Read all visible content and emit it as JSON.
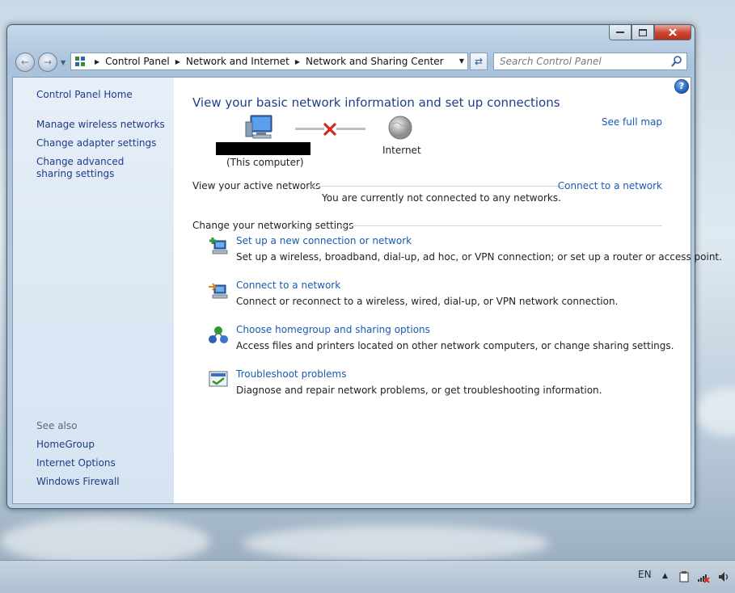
{
  "window": {
    "minimize_icon": "minimize-icon",
    "maximize_icon": "maximize-icon",
    "close_icon": "close-icon"
  },
  "nav": {
    "back_icon": "back-arrow-icon",
    "forward_icon": "forward-arrow-icon",
    "breadcrumbs": [
      "Control Panel",
      "Network and Internet",
      "Network and Sharing Center"
    ],
    "refresh_icon": "refresh-icon",
    "search_placeholder": "Search Control Panel"
  },
  "sidebar": {
    "home": "Control Panel Home",
    "links": [
      "Manage wireless networks",
      "Change adapter settings",
      "Change advanced sharing settings"
    ],
    "see_also_label": "See also",
    "see_also": [
      "HomeGroup",
      "Internet Options",
      "Windows Firewall"
    ]
  },
  "main": {
    "title": "View your basic network information and set up connections",
    "see_full_map": "See full map",
    "this_computer": "(This computer)",
    "internet": "Internet",
    "active_networks_label": "View your active networks",
    "connect_link": "Connect to a network",
    "not_connected": "You are currently not connected to any networks.",
    "change_settings_label": "Change your networking settings",
    "tasks": [
      {
        "title": "Set up a new connection or network",
        "desc": "Set up a wireless, broadband, dial-up, ad hoc, or VPN connection; or set up a router or access point.",
        "icon": "new-connection-icon"
      },
      {
        "title": "Connect to a network",
        "desc": "Connect or reconnect to a wireless, wired, dial-up, or VPN network connection.",
        "icon": "connect-network-icon"
      },
      {
        "title": "Choose homegroup and sharing options",
        "desc": "Access files and printers located on other network computers, or change sharing settings.",
        "icon": "homegroup-icon"
      },
      {
        "title": "Troubleshoot problems",
        "desc": "Diagnose and repair network problems, or get troubleshooting information.",
        "icon": "troubleshoot-icon"
      }
    ]
  },
  "taskbar": {
    "language": "EN"
  },
  "colors": {
    "link": "#1a5bb0",
    "title": "#1e3e8c",
    "sidebar_link": "#1e3b8a",
    "error_red": "#d42a1a"
  }
}
